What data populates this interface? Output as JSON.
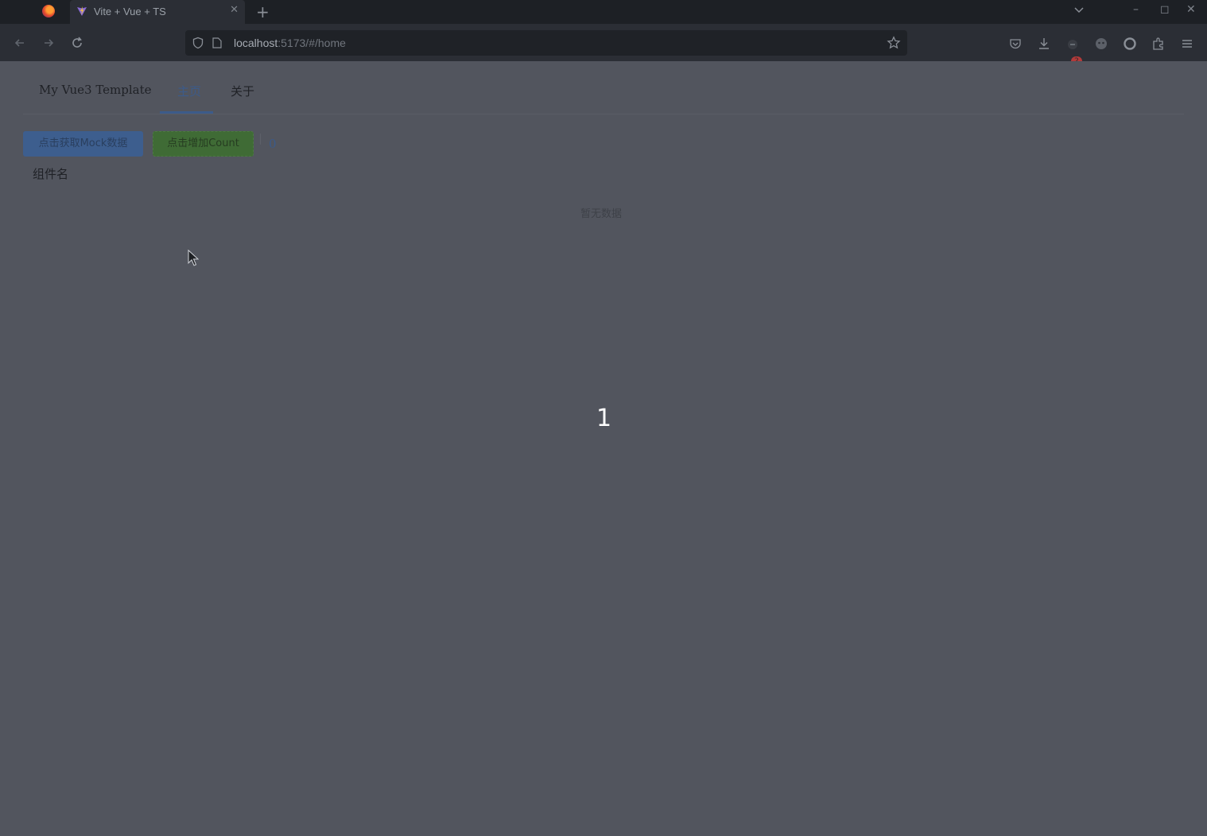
{
  "browser": {
    "tab_title": "Vite + Vue + TS",
    "tab_close": "✕",
    "new_tab": "+",
    "url_host": "localhost",
    "url_rest": ":5173/#/home",
    "downloads_badge": "2",
    "window_controls": [
      "–",
      "◻",
      "✕"
    ],
    "icons": [
      "firefox-icon",
      "vite-favicon",
      "list-all-tabs-icon",
      "back-icon",
      "forward-icon",
      "reload-icon",
      "shield-icon",
      "page-icon",
      "bookmark-star-icon",
      "pocket-icon",
      "download-icon",
      "extension-icon",
      "account-icon",
      "extensions-icon",
      "hamburger-menu-icon",
      "mouse-cursor-icon"
    ]
  },
  "app": {
    "brand": "My Vue3 Template",
    "menu": {
      "home": "主页",
      "about": "关于"
    },
    "buttons": {
      "mock": "点击获取Mock数据",
      "count": "点击增加Count"
    },
    "count_value": "0",
    "component_name_label": "组件名",
    "empty_text": "暂无数据",
    "overlay_number": "1"
  }
}
